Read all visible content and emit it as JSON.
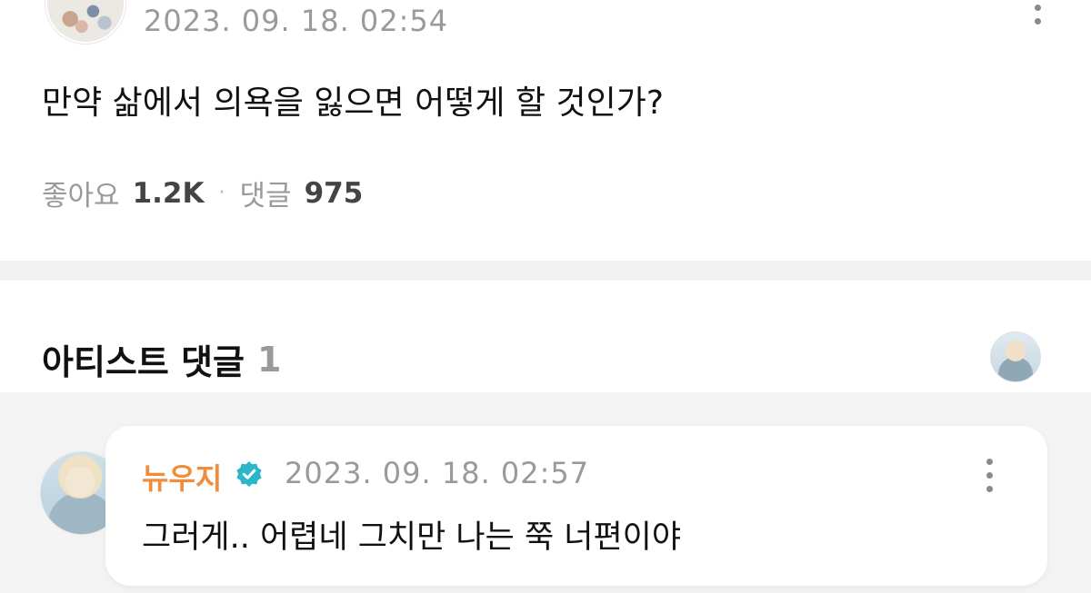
{
  "post": {
    "timestamp": "2023. 09. 18. 02:54",
    "text": "만약 삶에서 의욕을 잃으면 어떻게 할 것인가?",
    "likes_label": "좋아요",
    "likes_count": "1.2K",
    "separator": "·",
    "comments_label": "댓글",
    "comments_count": "975"
  },
  "artist_comments": {
    "title": "아티스트 댓글",
    "count": "1"
  },
  "comment": {
    "author": "뉴우지",
    "verified_icon": "verified-check-icon",
    "timestamp": "2023. 09. 18. 02:57",
    "text": "그러게.. 어렵네 그치만 나는 쭉 너편이야"
  },
  "colors": {
    "author": "#f08c3a",
    "verified": "#2bb7c9",
    "muted": "#9a9a9a",
    "section_bg": "#f3f3f3"
  }
}
